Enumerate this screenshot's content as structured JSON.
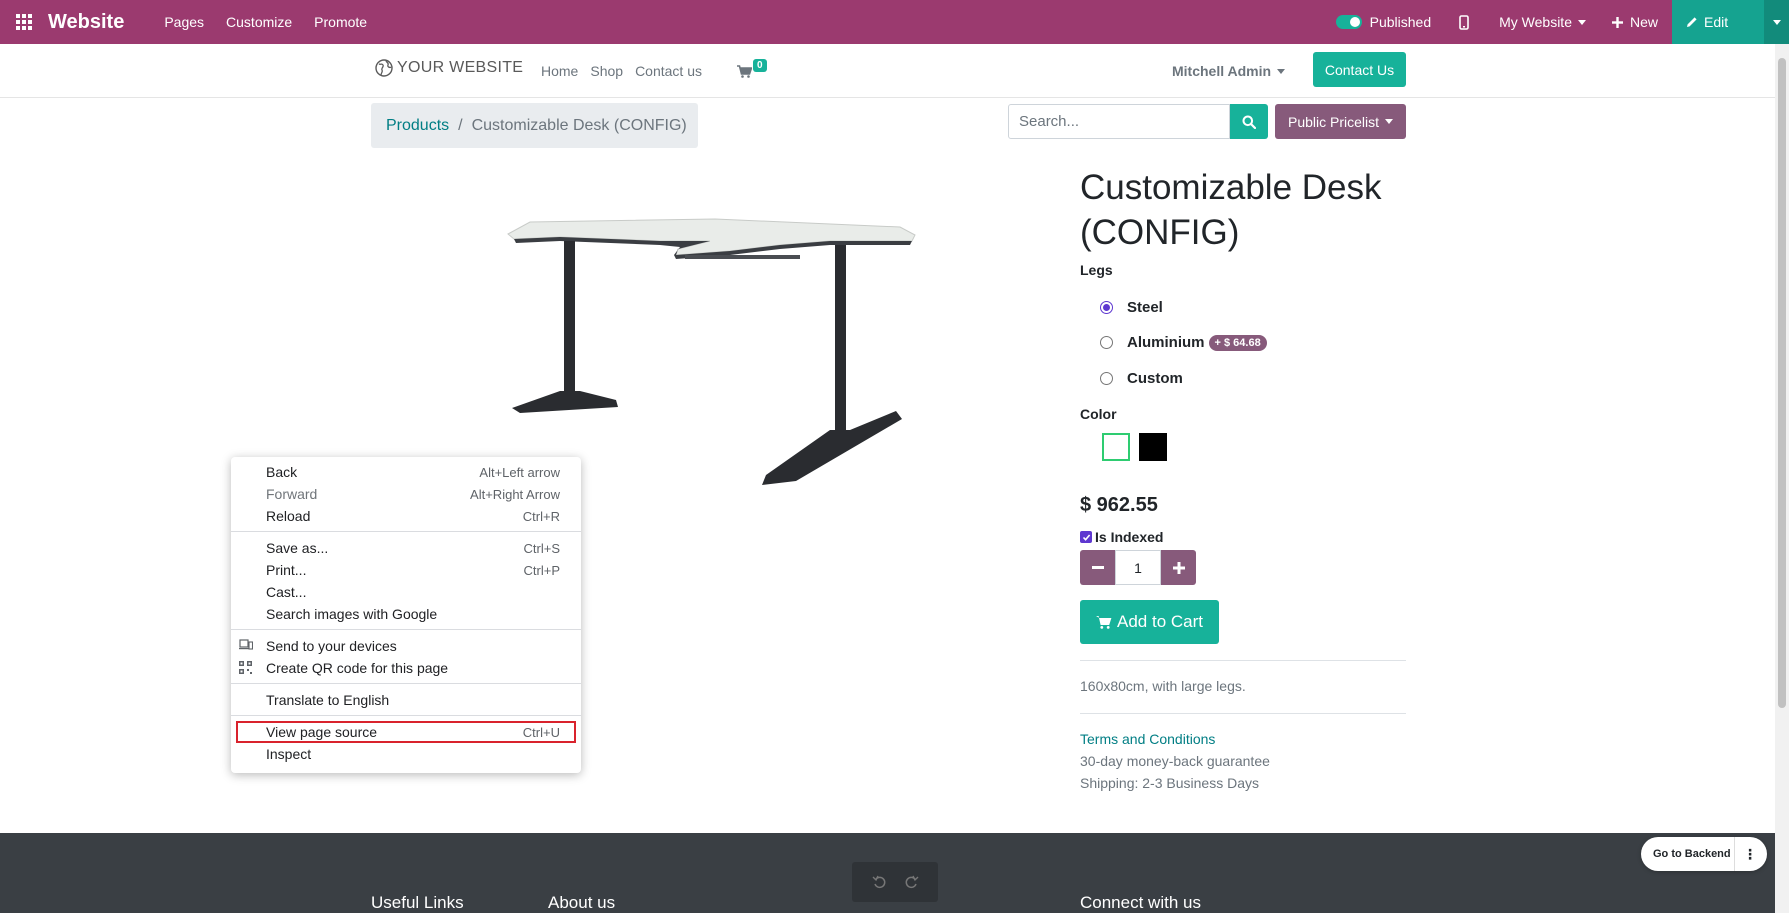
{
  "adminbar": {
    "brand": "Website",
    "menu": [
      "Pages",
      "Customize",
      "Promote"
    ],
    "published_label": "Published",
    "site_label": "My Website",
    "new_label": "New",
    "edit_label": "Edit"
  },
  "header": {
    "logo": "YOUR WEBSITE",
    "nav": [
      "Home",
      "Shop",
      "Contact us"
    ],
    "cart_count": "0",
    "user": "Mitchell Admin",
    "contact_button": "Contact Us"
  },
  "breadcrumb": {
    "parent": "Products",
    "separator": "/",
    "current": "Customizable Desk (CONFIG)"
  },
  "search": {
    "placeholder": "Search...",
    "pricelist": "Public Pricelist"
  },
  "product": {
    "title": "Customizable Desk (CONFIG)",
    "legs_label": "Legs",
    "legs_options": [
      {
        "label": "Steel",
        "selected": true
      },
      {
        "label": "Aluminium",
        "extra": "+ $ 64.68",
        "selected": false
      },
      {
        "label": "Custom",
        "selected": false
      }
    ],
    "color_label": "Color",
    "colors": [
      "#ffffff",
      "#000000"
    ],
    "price": "$ 962.55",
    "indexed_label": "Is Indexed",
    "quantity": "1",
    "add_to_cart": "Add to Cart",
    "description": "160x80cm, with large legs.",
    "terms": "Terms and Conditions",
    "guarantee": "30-day money-back guarantee",
    "shipping": "Shipping: 2-3 Business Days"
  },
  "footer": {
    "headings": [
      "Useful Links",
      "About us",
      "Connect with us"
    ],
    "go_backend": "Go to Backend"
  },
  "context_menu": {
    "items": [
      {
        "label": "Back",
        "shortcut": "Alt+Left arrow"
      },
      {
        "label": "Forward",
        "shortcut": "Alt+Right Arrow"
      },
      {
        "label": "Reload",
        "shortcut": "Ctrl+R"
      },
      {
        "label": "Save as...",
        "shortcut": "Ctrl+S"
      },
      {
        "label": "Print...",
        "shortcut": "Ctrl+P"
      },
      {
        "label": "Cast...",
        "shortcut": ""
      },
      {
        "label": "Search images with Google",
        "shortcut": ""
      },
      {
        "label": "Send to your devices",
        "shortcut": ""
      },
      {
        "label": "Create QR code for this page",
        "shortcut": ""
      },
      {
        "label": "Translate to English",
        "shortcut": ""
      },
      {
        "label": "View page source",
        "shortcut": "Ctrl+U"
      },
      {
        "label": "Inspect",
        "shortcut": ""
      }
    ]
  },
  "colors": {
    "adminbar": "#9b3a6f",
    "primary": "#17b29a",
    "secondary": "#875a7b",
    "footer": "#3a3f44",
    "highlight": "#d9232d"
  }
}
